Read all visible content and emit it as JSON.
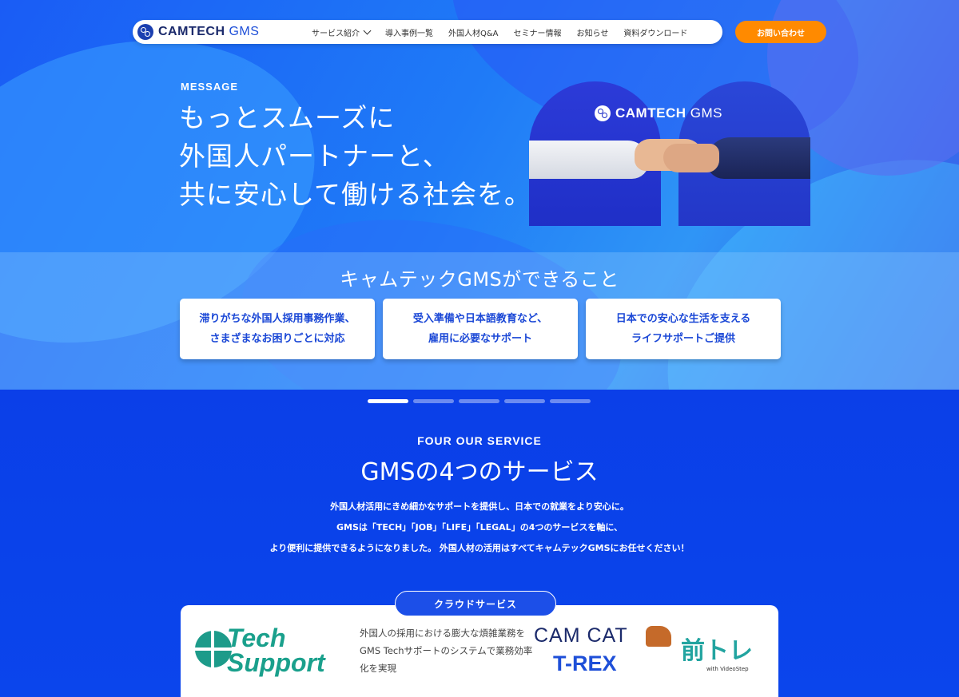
{
  "nav": {
    "logo_main": "CAMTECH",
    "logo_sub": "GMS",
    "items": [
      "サービス紹介",
      "導入事例一覧",
      "外国人材Q&A",
      "セミナー情報",
      "お知らせ",
      "資料ダウンロード"
    ],
    "contact_label": "お問い合わせ"
  },
  "hero": {
    "eyebrow": "MESSAGE",
    "title_lines": [
      "もっとスムーズに",
      "外国人パートナーと、",
      "共に安心して働ける社会を。"
    ],
    "visual_logo_main": "CAMTECH",
    "visual_logo_sub": "GMS"
  },
  "capabilities": {
    "title": "キャムテックGMSができること",
    "cards": [
      {
        "line1": "滞りがちな外国人採用事務作業、",
        "line2": "さまざまなお困りごとに対応"
      },
      {
        "line1": "受入準備や日本語教育など、",
        "line2": "雇用に必要なサポート"
      },
      {
        "line1": "日本での安心な生活を支える",
        "line2": "ライフサポートご提供"
      }
    ]
  },
  "carousel": {
    "total": 5,
    "active_index": 0
  },
  "services": {
    "eyebrow": "FOUR OUR SERVICE",
    "title": "GMSの4つのサービス",
    "desc_lines": [
      "外国人材活用にきめ細かなサポートを提供し、日本での就業をより安心に。",
      "GMSは「TECH」「JOB」「LIFE」「LEGAL」の4つのサービスを軸に、",
      "より便利に提供できるようになりました。 外国人材の活用はすべてキャムテックGMSにお任せください！"
    ],
    "cloud_tag": "クラウドサービス",
    "tech_support": {
      "line1": "Tech",
      "line2": "Support"
    },
    "tech_desc": "外国人の採用における膨大な煩雑業務をGMS Techサポートのシステムで業務効率化を実現",
    "camcat": "CAM CAT",
    "trex": "T-REX",
    "maetore": "前トレ",
    "maetore_sub": "with VideoStep"
  },
  "colors": {
    "accent_orange": "#ff8a00",
    "brand_blue": "#1a47d6",
    "tech_green": "#1aa08c"
  }
}
